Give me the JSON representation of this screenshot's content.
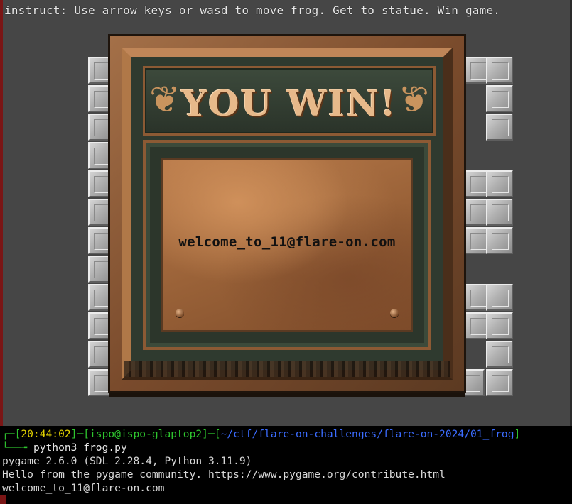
{
  "game": {
    "instruct_text": "instruct: Use arrow keys or wasd to move frog. Get to statue. Win game.",
    "win_title": "YOU WIN!",
    "flag_text": "welcome_to_11@flare-on.com",
    "colors": {
      "background": "#464646",
      "plaque": "#7a4b2c",
      "wall": "#b0b0b0"
    }
  },
  "terminal": {
    "prompt": {
      "time": "20:44:02",
      "user_host": "ispo@ispo-glaptop2",
      "cwd": "~/ctf/flare-on-challenges/flare-on-2024/01_frog"
    },
    "command": "python3 frog.py",
    "output": [
      "pygame 2.6.0 (SDL 2.28.4, Python 3.11.9)",
      "Hello from the pygame community. https://www.pygame.org/contribute.html",
      "welcome_to_11@flare-on.com"
    ],
    "colors": {
      "border": "#2ec42e",
      "time": "#e0d000",
      "user": "#2ec42e",
      "path": "#3b6cff"
    }
  }
}
